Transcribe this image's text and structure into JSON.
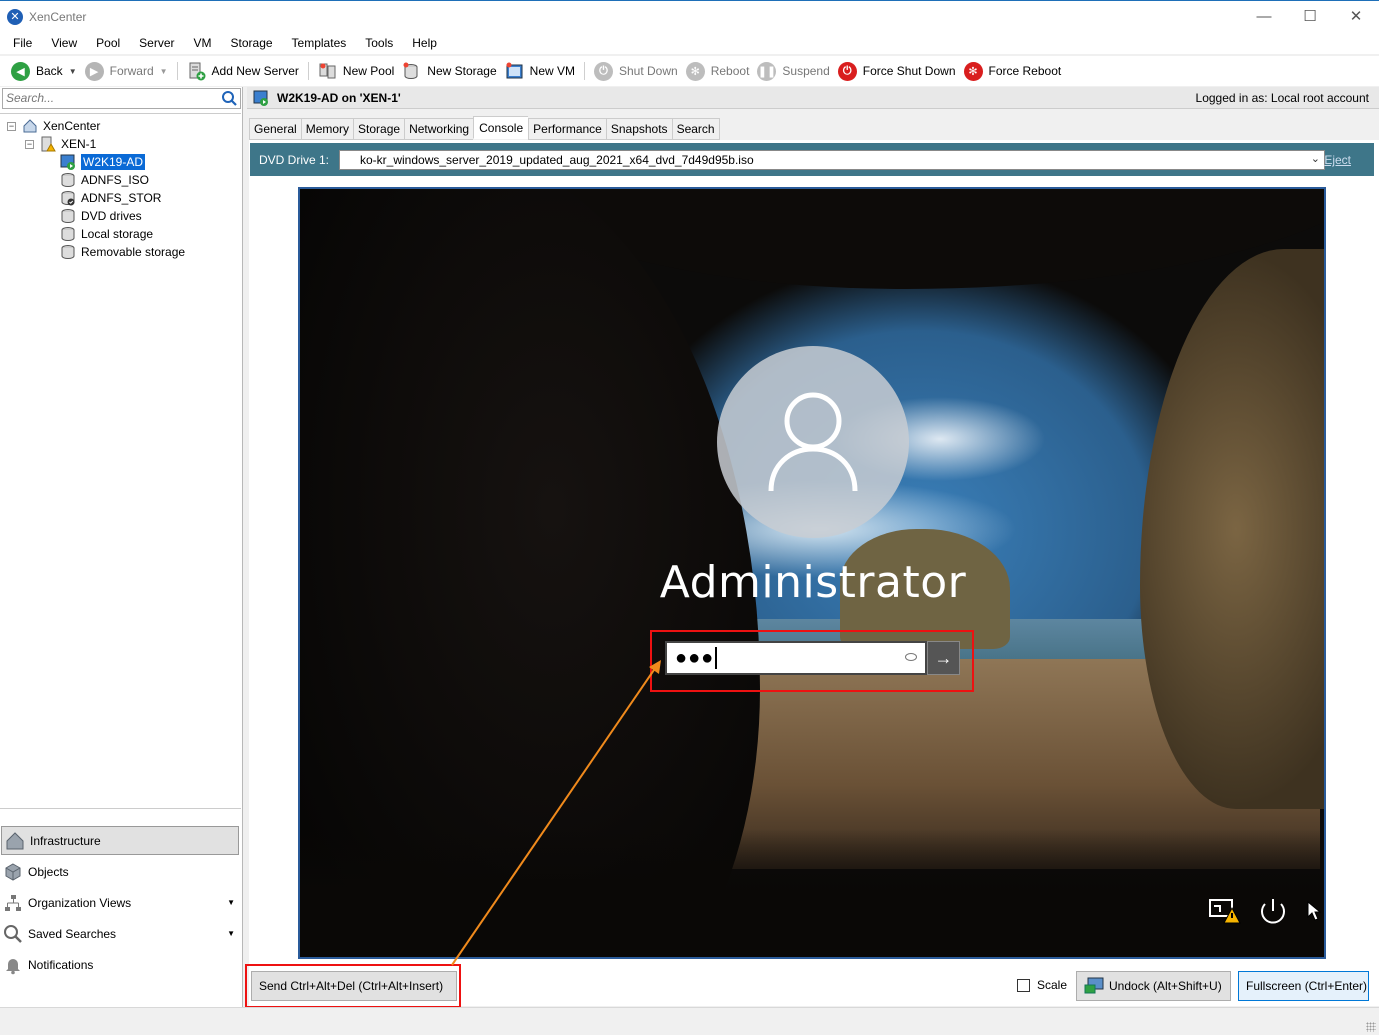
{
  "window": {
    "title": "XenCenter",
    "minimize": "—",
    "maximize": "☐",
    "close": "✕"
  },
  "menu": [
    "File",
    "View",
    "Pool",
    "Server",
    "VM",
    "Storage",
    "Templates",
    "Tools",
    "Help"
  ],
  "toolbar": {
    "back": "Back",
    "forward": "Forward",
    "add_new_server": "Add New Server",
    "new_pool": "New Pool",
    "new_storage": "New Storage",
    "new_vm": "New VM",
    "shut_down": "Shut Down",
    "reboot": "Reboot",
    "suspend": "Suspend",
    "force_shut_down": "Force Shut Down",
    "force_reboot": "Force Reboot"
  },
  "search": {
    "placeholder": "Search..."
  },
  "tree": {
    "root": "XenCenter",
    "host": "XEN-1",
    "vm": "W2K19-AD",
    "storage": [
      "ADNFS_ISO",
      "ADNFS_STOR",
      "DVD drives",
      "Local storage",
      "Removable storage"
    ]
  },
  "nav": {
    "infrastructure": "Infrastructure",
    "objects": "Objects",
    "organization_views": "Organization Views",
    "saved_searches": "Saved Searches",
    "notifications": "Notifications"
  },
  "header": {
    "vm_title": "W2K19-AD on 'XEN-1'",
    "login": "Logged in as: Local root account"
  },
  "tabs": [
    "General",
    "Memory",
    "Storage",
    "Networking",
    "Console",
    "Performance",
    "Snapshots",
    "Search"
  ],
  "active_tab": "Console",
  "dvd": {
    "label": "DVD Drive 1:",
    "selected": "ko-kr_windows_server_2019_updated_aug_2021_x64_dvd_7d49d95b.iso",
    "eject": "Eject"
  },
  "console": {
    "username": "Administrator",
    "password_mask": "●●●",
    "submit_arrow": "→"
  },
  "bottom": {
    "send_cad": "Send Ctrl+Alt+Del (Ctrl+Alt+Insert)",
    "scale": "Scale",
    "undock": "Undock (Alt+Shift+U)",
    "fullscreen": "Fullscreen (Ctrl+Enter)"
  },
  "colors": {
    "accent": "#0a6ad6",
    "dvd_bar": "#3e7689",
    "highlight": "#e11111",
    "arrow": "#f08a1c"
  }
}
